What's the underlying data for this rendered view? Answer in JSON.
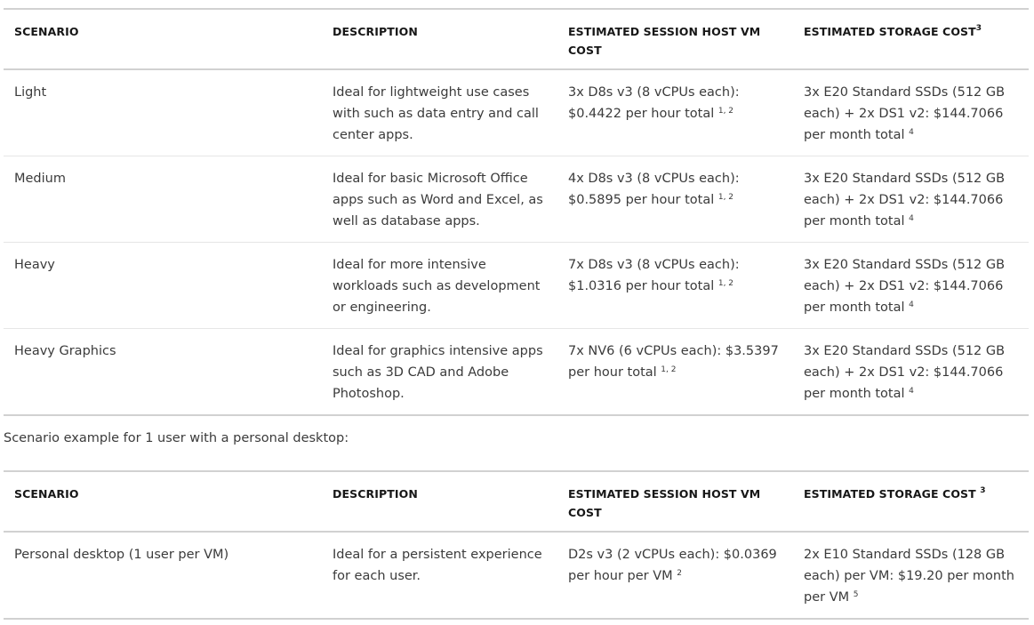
{
  "table1": {
    "headers": {
      "scenario": "SCENARIO",
      "description": "DESCRIPTION",
      "vm_cost": "ESTIMATED SESSION HOST VM COST",
      "storage_cost": "ESTIMATED STORAGE COST",
      "storage_cost_note": "3"
    },
    "rows": [
      {
        "scenario": "Light",
        "description": "Ideal for lightweight use cases with such as data entry and call center apps.",
        "vm_cost": "3x D8s v3 (8 vCPUs each): $0.4422 per hour total",
        "vm_cost_note": "1, 2",
        "storage_cost": "3x E20 Standard SSDs (512 GB each) + 2x DS1 v2: $144.7066 per month total",
        "storage_cost_note": "4"
      },
      {
        "scenario": "Medium",
        "description": "Ideal for basic Microsoft Office apps such as Word and Excel, as well as database apps.",
        "vm_cost": "4x D8s v3 (8 vCPUs each): $0.5895 per hour total",
        "vm_cost_note": "1, 2",
        "storage_cost": "3x E20 Standard SSDs (512 GB each) + 2x DS1 v2: $144.7066 per month total",
        "storage_cost_note": "4"
      },
      {
        "scenario": "Heavy",
        "description": "Ideal for more intensive workloads such as development or engineering.",
        "vm_cost": "7x D8s v3 (8 vCPUs each): $1.0316 per hour total",
        "vm_cost_note": "1, 2",
        "storage_cost": "3x E20 Standard SSDs (512 GB each) + 2x DS1 v2: $144.7066 per month total",
        "storage_cost_note": "4"
      },
      {
        "scenario": "Heavy Graphics",
        "description": "Ideal for graphics intensive apps such as 3D CAD and Adobe Photoshop.",
        "vm_cost": "7x NV6 (6 vCPUs each): $3.5397 per hour total",
        "vm_cost_note": "1, 2",
        "storage_cost": "3x E20 Standard SSDs (512 GB each) + 2x DS1 v2: $144.7066 per month total",
        "storage_cost_note": "4"
      }
    ]
  },
  "caption": "Scenario example for 1 user with a personal desktop:",
  "table2": {
    "headers": {
      "scenario": "SCENARIO",
      "description": "DESCRIPTION",
      "vm_cost": "ESTIMATED SESSION HOST VM COST",
      "storage_cost": "ESTIMATED STORAGE COST ",
      "storage_cost_note": "3"
    },
    "rows": [
      {
        "scenario": "Personal desktop (1 user per VM)",
        "description": "Ideal for a persistent experience for each user.",
        "vm_cost": "D2s v3 (2 vCPUs each): $0.0369 per hour per VM",
        "vm_cost_note": "2",
        "storage_cost": "2x E10 Standard SSDs (128 GB each) per VM: $19.20 per month per VM",
        "storage_cost_note": "5"
      }
    ]
  }
}
